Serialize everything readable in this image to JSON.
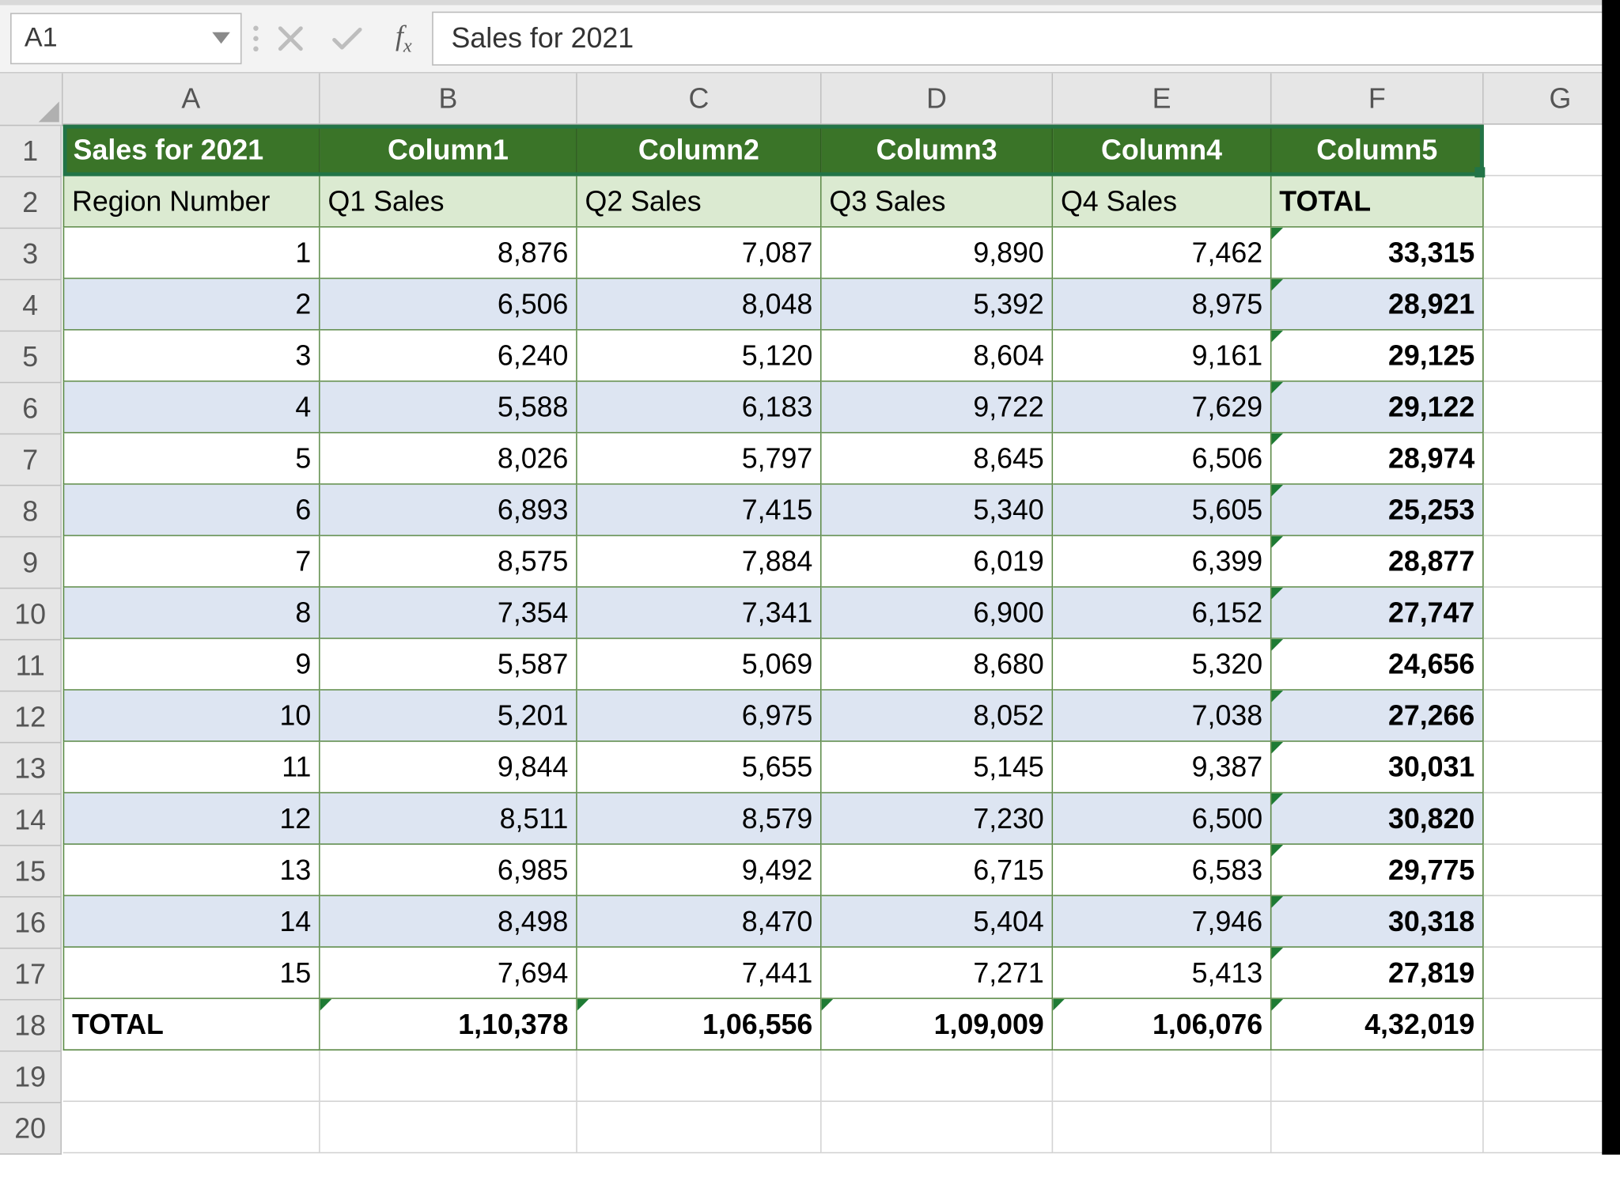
{
  "formula_bar": {
    "name_box": "A1",
    "formula_value": "Sales for 2021"
  },
  "columns": [
    "A",
    "B",
    "C",
    "D",
    "E",
    "F",
    "G"
  ],
  "row_numbers": [
    "1",
    "2",
    "3",
    "4",
    "5",
    "6",
    "7",
    "8",
    "9",
    "10",
    "11",
    "12",
    "13",
    "14",
    "15",
    "16",
    "17",
    "18",
    "19",
    "20"
  ],
  "table": {
    "header_row": [
      "Sales for 2021",
      "Column1",
      "Column2",
      "Column3",
      "Column4",
      "Column5"
    ],
    "sub_header": [
      "Region Number",
      "Q1 Sales",
      "Q2 Sales",
      "Q3 Sales",
      "Q4 Sales",
      "TOTAL"
    ],
    "rows": [
      [
        "1",
        "8,876",
        "7,087",
        "9,890",
        "7,462",
        "33,315"
      ],
      [
        "2",
        "6,506",
        "8,048",
        "5,392",
        "8,975",
        "28,921"
      ],
      [
        "3",
        "6,240",
        "5,120",
        "8,604",
        "9,161",
        "29,125"
      ],
      [
        "4",
        "5,588",
        "6,183",
        "9,722",
        "7,629",
        "29,122"
      ],
      [
        "5",
        "8,026",
        "5,797",
        "8,645",
        "6,506",
        "28,974"
      ],
      [
        "6",
        "6,893",
        "7,415",
        "5,340",
        "5,605",
        "25,253"
      ],
      [
        "7",
        "8,575",
        "7,884",
        "6,019",
        "6,399",
        "28,877"
      ],
      [
        "8",
        "7,354",
        "7,341",
        "6,900",
        "6,152",
        "27,747"
      ],
      [
        "9",
        "5,587",
        "5,069",
        "8,680",
        "5,320",
        "24,656"
      ],
      [
        "10",
        "5,201",
        "6,975",
        "8,052",
        "7,038",
        "27,266"
      ],
      [
        "11",
        "9,844",
        "5,655",
        "5,145",
        "9,387",
        "30,031"
      ],
      [
        "12",
        "8,511",
        "8,579",
        "7,230",
        "6,500",
        "30,820"
      ],
      [
        "13",
        "6,985",
        "9,492",
        "6,715",
        "6,583",
        "29,775"
      ],
      [
        "14",
        "8,498",
        "8,470",
        "5,404",
        "7,946",
        "30,318"
      ],
      [
        "15",
        "7,694",
        "7,441",
        "7,271",
        "5,413",
        "27,819"
      ]
    ],
    "total_row": [
      "TOTAL",
      "1,10,378",
      "1,06,556",
      "1,09,009",
      "1,06,076",
      "4,32,019"
    ]
  }
}
